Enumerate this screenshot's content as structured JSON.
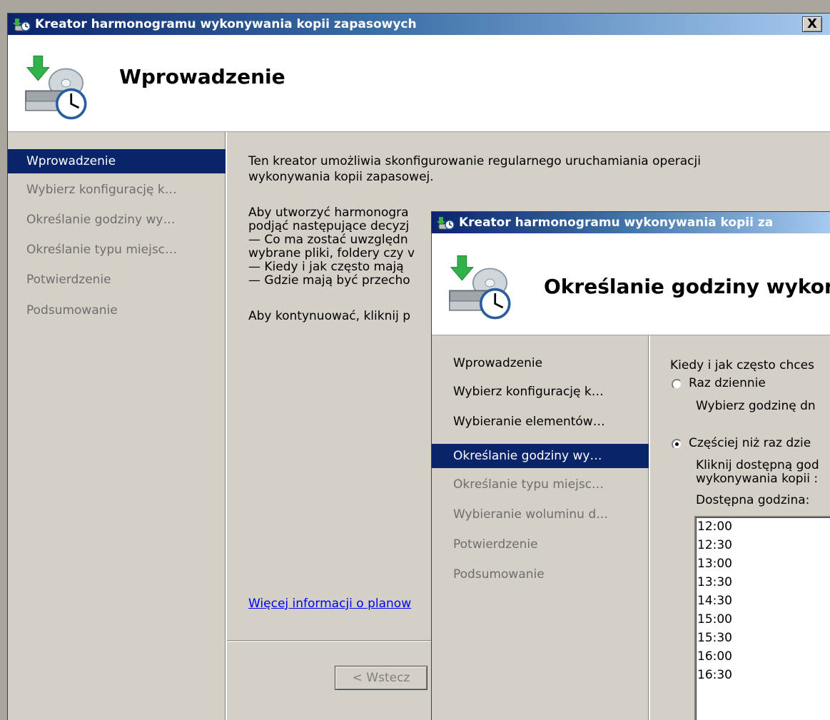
{
  "back_window": {
    "title": "Kreator harmonogramu wykonywania kopii zapasowych",
    "close_label": "X",
    "header_title": "Wprowadzenie",
    "nav": [
      {
        "label": "Wprowadzenie",
        "state": "active"
      },
      {
        "label": "Wybierz konfigurację k…",
        "state": "disabled"
      },
      {
        "label": "Określanie godziny wy…",
        "state": "disabled"
      },
      {
        "label": "Określanie typu miejsc…",
        "state": "disabled"
      },
      {
        "label": "Potwierdzenie",
        "state": "disabled"
      },
      {
        "label": "Podsumowanie",
        "state": "disabled"
      }
    ],
    "content": {
      "para1_line1": "Ten kreator umożliwia skonfigurowanie regularnego uruchamiania operacji",
      "para1_line2": "wykonywania kopii zapasowej.",
      "para2_lines": [
        "Aby utworzyć harmonogra",
        "podjąć następujące decyzj",
        "— Co ma zostać uwzględn",
        "wybrane pliki, foldery czy v",
        "— Kiedy i jak często mają",
        "— Gdzie mają być przecho"
      ],
      "para3": "Aby kontynuować, kliknij p",
      "more_info_link": "Więcej informacji o planow"
    },
    "back_button": "< Wstecz"
  },
  "front_window": {
    "title": "Kreator harmonogramu wykonywania kopii za",
    "header_title": "Określanie godziny wykona",
    "nav": [
      {
        "label": "Wprowadzenie",
        "state": "enabled"
      },
      {
        "label": "Wybierz konfigurację k…",
        "state": "enabled"
      },
      {
        "label": "Wybieranie elementów…",
        "state": "enabled"
      },
      {
        "label": "Określanie godziny wy…",
        "state": "active"
      },
      {
        "label": "Określanie typu miejsc…",
        "state": "disabled"
      },
      {
        "label": "Wybieranie woluminu d…",
        "state": "disabled"
      },
      {
        "label": "Potwierdzenie",
        "state": "disabled"
      },
      {
        "label": "Podsumowanie",
        "state": "disabled"
      }
    ],
    "content": {
      "question": "Kiedy i jak często chces",
      "radio_once_label": "Raz dziennie",
      "radio_once_checked": false,
      "once_hint": "Wybierz godzinę dn",
      "radio_more_label": "Częściej niż raz dzie",
      "radio_more_checked": true,
      "more_hint_line1": "Kliknij dostępną god",
      "more_hint_line2": "wykonywania kopii :",
      "available_label": "Dostępna godzina:",
      "available_times": [
        "12:00",
        "12:30",
        "13:00",
        "13:30",
        "14:30",
        "15:00",
        "15:30",
        "16:00",
        "16:30"
      ]
    }
  }
}
